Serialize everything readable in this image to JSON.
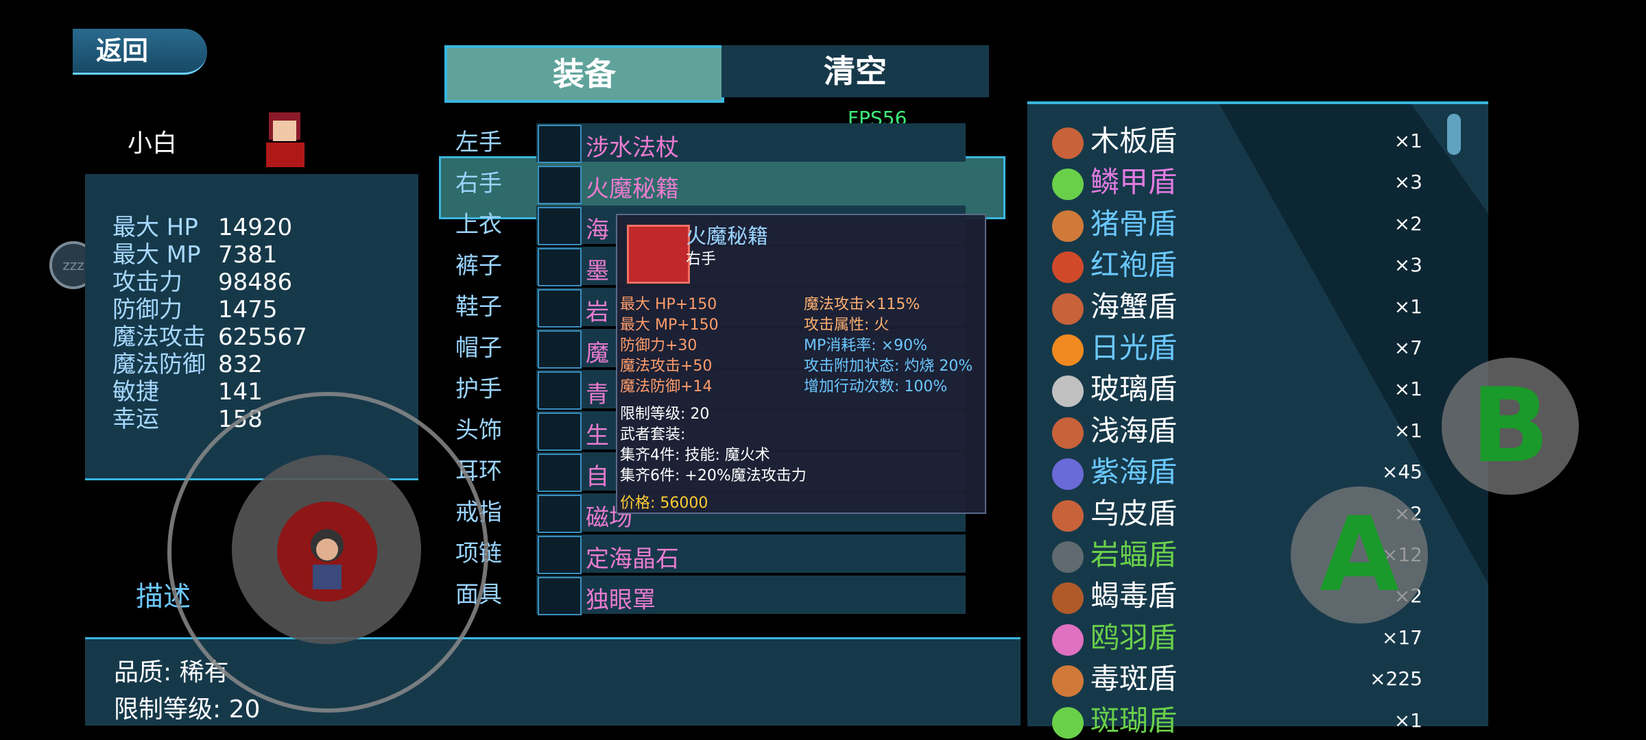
{
  "header": {
    "back_label": "返回",
    "tab_equip": "装备",
    "tab_clear": "清空",
    "fps": "FPS56"
  },
  "character": {
    "name": "小白",
    "stats": [
      {
        "label": "最大 HP",
        "value": "14920"
      },
      {
        "label": "最大 MP",
        "value": "7381"
      },
      {
        "label": "攻击力",
        "value": "98486"
      },
      {
        "label": "防御力",
        "value": "1475"
      },
      {
        "label": "魔法攻击",
        "value": "625567"
      },
      {
        "label": "魔法防御",
        "value": "832"
      },
      {
        "label": "敏捷",
        "value": "141"
      },
      {
        "label": "幸运",
        "value": "158"
      }
    ],
    "status_icon": "zzz"
  },
  "slots": [
    {
      "label": "左手",
      "item": "涉水法杖"
    },
    {
      "label": "右手",
      "item": "火魔秘籍"
    },
    {
      "label": "上衣",
      "item": "海"
    },
    {
      "label": "裤子",
      "item": "墨"
    },
    {
      "label": "鞋子",
      "item": "岩"
    },
    {
      "label": "帽子",
      "item": "魔"
    },
    {
      "label": "护手",
      "item": "青"
    },
    {
      "label": "头饰",
      "item": "生"
    },
    {
      "label": "耳环",
      "item": "自"
    },
    {
      "label": "戒指",
      "item": "磁场"
    },
    {
      "label": "项链",
      "item": "定海晶石"
    },
    {
      "label": "面具",
      "item": "独眼罩"
    }
  ],
  "tooltip": {
    "title": "火魔秘籍",
    "slot": "右手",
    "bonuses_left": [
      "最大 HP+150",
      "最大 MP+150",
      "防御力+30",
      "魔法攻击+50",
      "魔法防御+14"
    ],
    "bonuses_right": [
      "魔法攻击×115%",
      "攻击属性: 火",
      "MP消耗率: ×90%",
      "攻击附加状态: 灼烧 20%",
      "增加行动次数: 100%"
    ],
    "level_req": "限制等级: 20",
    "set_title": "武者套装:",
    "set4": "集齐4件: 技能: 魔火术",
    "set6": "集齐6件: +20%魔法攻击力",
    "price": "价格: 56000"
  },
  "description": {
    "title": "描述",
    "quality": "品质: 稀有",
    "level": "限制等级: 20"
  },
  "inventory": [
    {
      "name": "木板盾",
      "count": "×1",
      "color": "#ffffff",
      "icon": "#c8623a"
    },
    {
      "name": "鳞甲盾",
      "count": "×3",
      "color": "#e07be0",
      "icon": "#6ad04a"
    },
    {
      "name": "猪骨盾",
      "count": "×2",
      "color": "#6bc8ff",
      "icon": "#d07a3a"
    },
    {
      "name": "红袍盾",
      "count": "×3",
      "color": "#6bc8ff",
      "icon": "#d04a2a"
    },
    {
      "name": "海蟹盾",
      "count": "×1",
      "color": "#ffffff",
      "icon": "#c8623a"
    },
    {
      "name": "日光盾",
      "count": "×7",
      "color": "#6bc8ff",
      "icon": "#f08a20"
    },
    {
      "name": "玻璃盾",
      "count": "×1",
      "color": "#ffffff",
      "icon": "#c0c0c0"
    },
    {
      "name": "浅海盾",
      "count": "×1",
      "color": "#ffffff",
      "icon": "#c8623a"
    },
    {
      "name": "紫海盾",
      "count": "×45",
      "color": "#6bc8ff",
      "icon": "#6a6ad8"
    },
    {
      "name": "乌皮盾",
      "count": "×2",
      "color": "#ffffff",
      "icon": "#c8623a"
    },
    {
      "name": "岩蝠盾",
      "count": "×12",
      "color": "#6ad04a",
      "icon": "#606a70"
    },
    {
      "name": "蝎毒盾",
      "count": "×2",
      "color": "#ffffff",
      "icon": "#b05a2a"
    },
    {
      "name": "鸥羽盾",
      "count": "×17",
      "color": "#6ad04a",
      "icon": "#e070c0"
    },
    {
      "name": "毒斑盾",
      "count": "×225",
      "color": "#ffffff",
      "icon": "#d07a3a"
    },
    {
      "name": "斑瑚盾",
      "count": "×1",
      "color": "#6ad04a",
      "icon": "#6ad04a"
    }
  ],
  "controls": {
    "a": "A",
    "b": "B"
  }
}
